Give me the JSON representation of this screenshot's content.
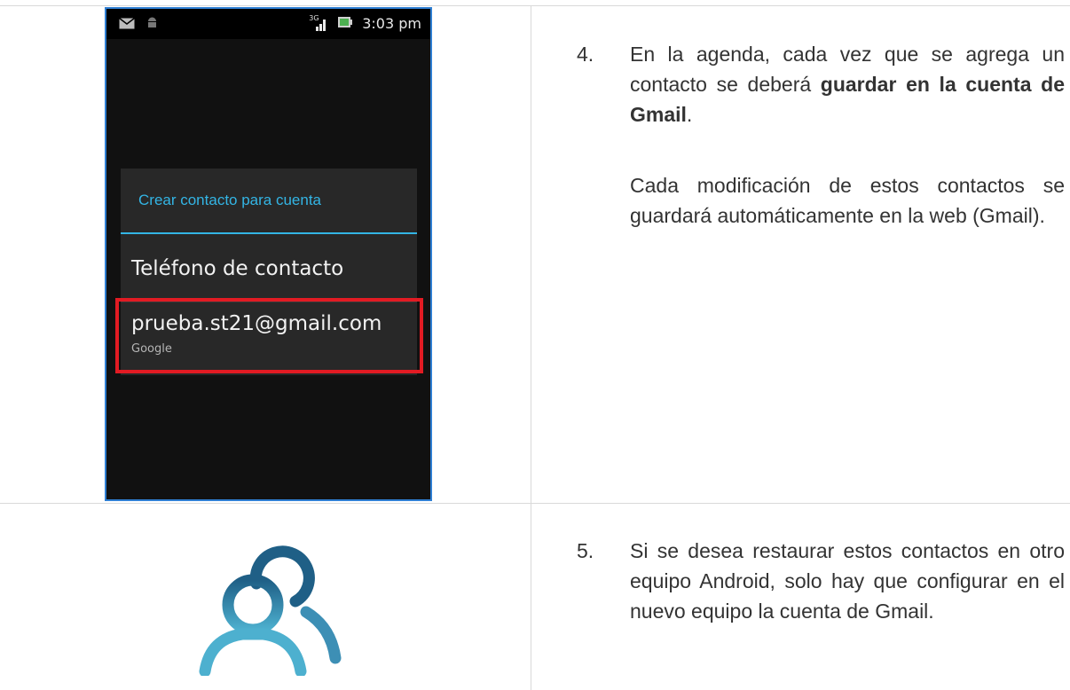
{
  "phone": {
    "status_time": "3:03 pm",
    "network_label": "3G",
    "dialog_title": "Crear contacto para cuenta",
    "option_phone": "Teléfono de contacto",
    "option_account": "prueba.st21@gmail.com",
    "option_account_sub": "Google"
  },
  "steps": [
    {
      "number": "4.",
      "text_before": "En la agenda, cada vez que se agrega un contacto se deberá ",
      "text_bold": "guardar en la cuenta de Gmail",
      "text_after": ".",
      "paragraph2": "Cada modificación de estos contactos se guardará automáticamente en la web (Gmail)."
    },
    {
      "number": "5.",
      "text": "Si se desea restaurar estos  contactos en otro equipo Android, solo hay que configurar en el nuevo equipo  la cuenta de Gmail."
    }
  ],
  "colors": {
    "accent_blue": "#33b5e5",
    "highlight_red": "#e21b23",
    "icon_dark": "#1f5f86",
    "icon_light": "#4db0cf"
  },
  "icons": [
    "mail-icon",
    "android-icon",
    "signal-icon",
    "battery-icon",
    "contacts-icon"
  ]
}
